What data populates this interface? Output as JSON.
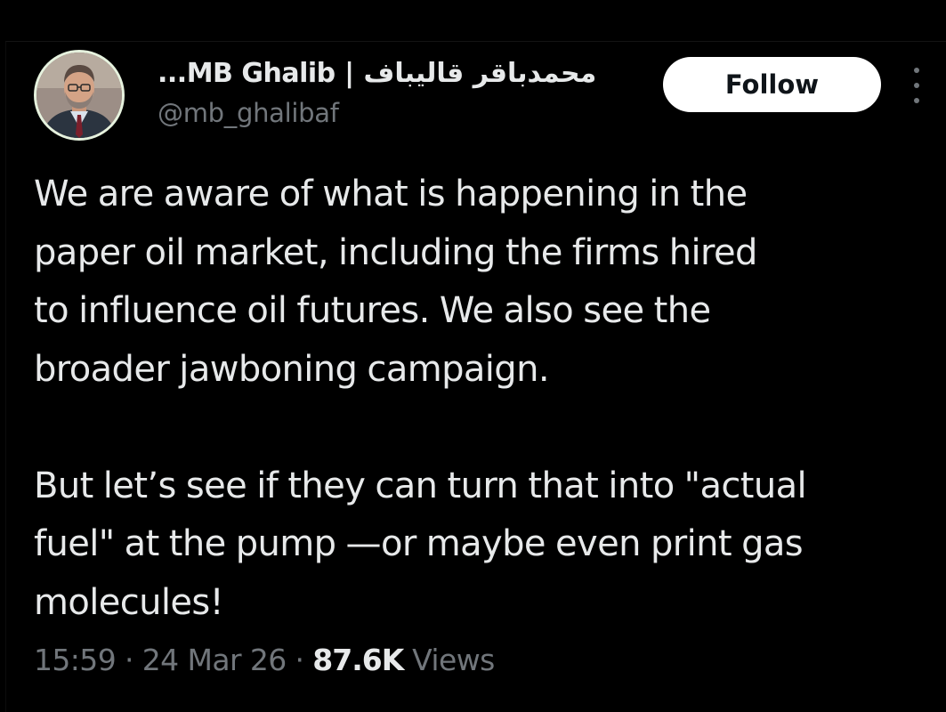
{
  "author": {
    "display_name": "محمدباقر قالیباف | MB Ghalib...",
    "handle": "@mb_ghalibaf",
    "avatar_icon": "profile-photo"
  },
  "actions": {
    "follow_label": "Follow",
    "more_icon": "more-vertical-icon"
  },
  "tweet": {
    "paragraphs": [
      "We are aware of what is happening in the\npaper oil market, including the firms hired\nto influence oil futures. We also see the\nbroader jawboning campaign.",
      "But let’s see if they can turn that into \"actual\nfuel\" at the pump —or maybe even print gas\nmolecules!"
    ]
  },
  "meta": {
    "time": "15:59",
    "separator": "·",
    "date": "24 Mar 26",
    "views_count": "87.6K",
    "views_label": "Views"
  },
  "colors": {
    "background": "#000000",
    "text_primary": "#e7e9ea",
    "text_secondary": "#71767b",
    "follow_bg": "#ffffff",
    "follow_text": "#0f1419",
    "avatar_ring": "#e6f2de"
  }
}
